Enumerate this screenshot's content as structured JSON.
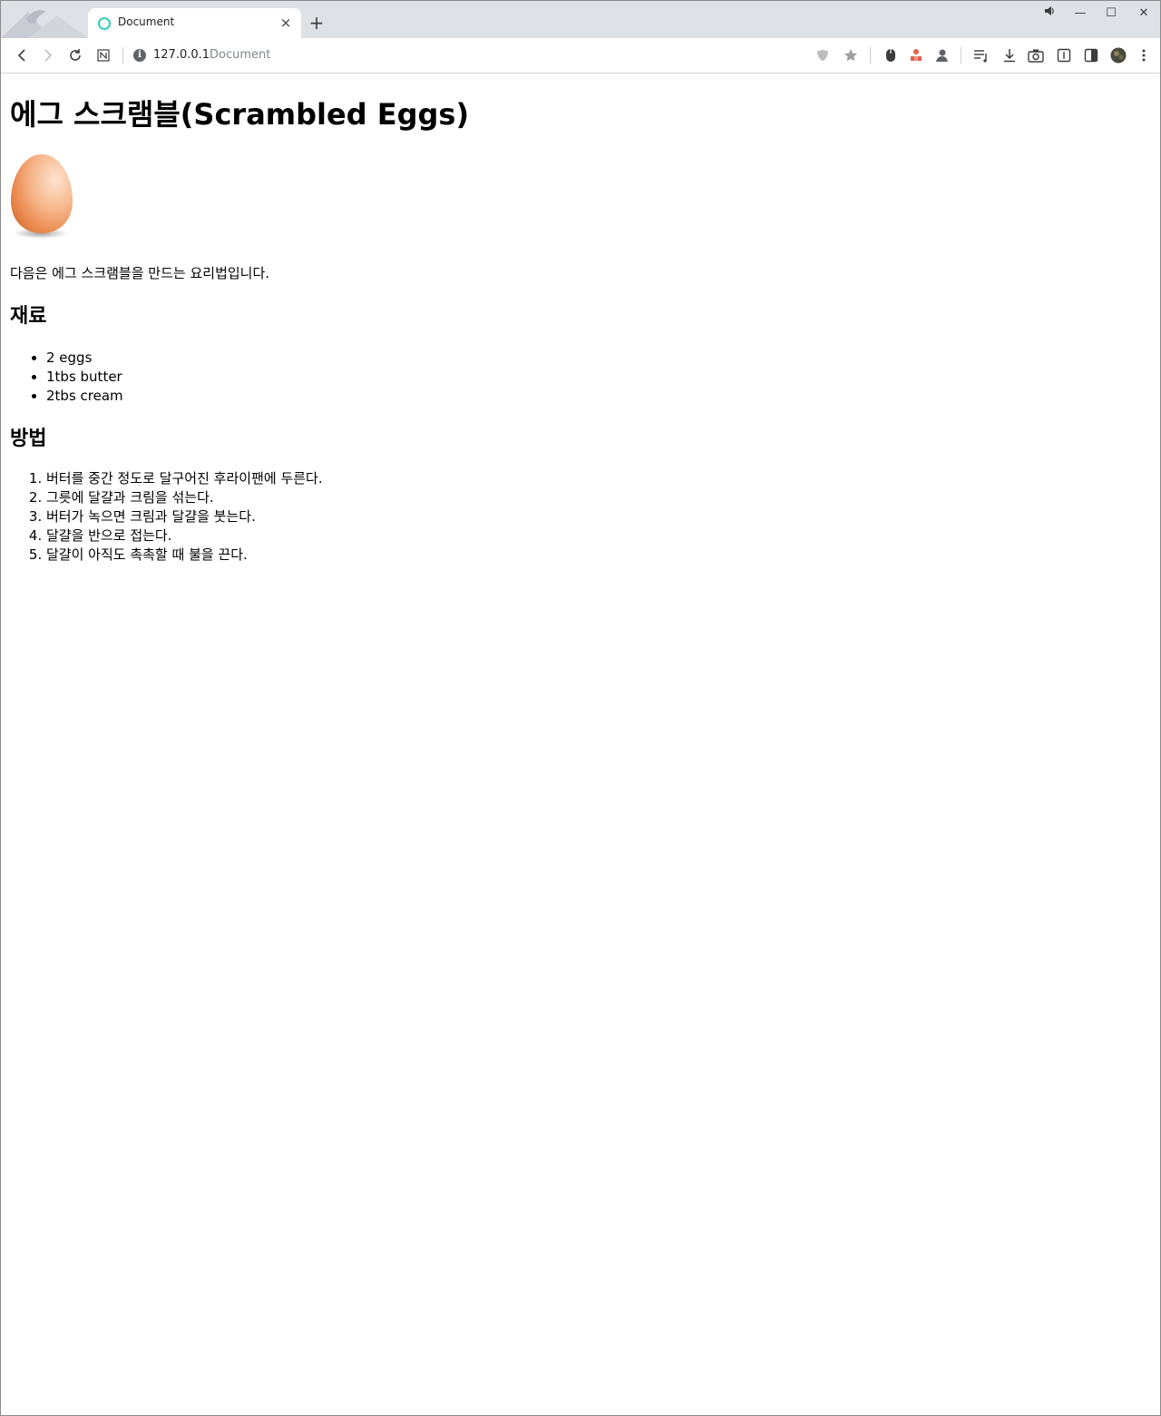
{
  "browser": {
    "tab": {
      "title": "Document",
      "close": "×"
    },
    "new_tab": "+",
    "window_controls": {
      "mute": "speaker-icon",
      "minimize": "—",
      "maximize": "☐",
      "close": "✕"
    },
    "url": {
      "host": "127.0.0.1",
      "title": "Document"
    },
    "toolbar_icons": [
      "back-icon",
      "forward-icon",
      "reload-icon",
      "notion-icon",
      "shield-icon",
      "star-icon",
      "mouse-icon",
      "extension-icon",
      "user-icon",
      "playlist-icon",
      "download-icon",
      "camera-icon",
      "reader-icon",
      "sidebar-icon",
      "avatar",
      "menu-icon"
    ]
  },
  "page": {
    "title": "에그 스크램블(Scrambled Eggs)",
    "intro": "다음은 에그 스크램블을 만드는 요리법입니다.",
    "ingredients_heading": "재료",
    "ingredients": [
      "2 eggs",
      "1tbs butter",
      "2tbs cream"
    ],
    "method_heading": "방법",
    "steps": [
      "버터를 중간 정도로 달구어진 후라이팬에 두른다.",
      "그릇에 달걀과 크림을 섞는다.",
      "버터가 녹으면 크림과 달걀을 붓는다.",
      "달걀을 반으로 접는다.",
      "달걀이 아직도 촉촉할 때 불을 끈다."
    ]
  },
  "colors": {
    "tabstrip": "#dee1e6",
    "favicon": "#2ecfb6",
    "egg": "#f0a070"
  }
}
